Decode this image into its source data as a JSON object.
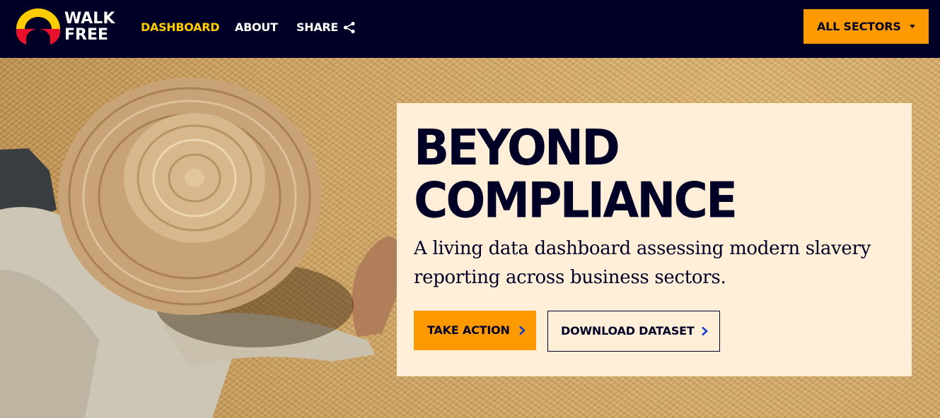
{
  "nav": {
    "logo_text": [
      "WALK",
      "FREE"
    ],
    "links": [
      {
        "label": "DASHBOARD",
        "active": true
      },
      {
        "label": "ABOUT",
        "active": false
      },
      {
        "label": "SHARE",
        "active": false
      }
    ],
    "share_icon": "share-icon",
    "sectors_dropdown": {
      "label": "ALL SECTORS",
      "icon": "caret-down-icon"
    }
  },
  "hero": {
    "image": "farmer-straw-hat-drying-grain",
    "title_lines": [
      "BEYOND",
      "COMPLIANCE"
    ],
    "subtitle": "A living data dashboard assessing modern slavery reporting across business sectors.",
    "buttons": [
      {
        "label": "TAKE ACTION",
        "icon": "chevron-right-icon"
      },
      {
        "label": "DOWNLOAD DATASET",
        "icon": "chevron-right-icon"
      }
    ]
  },
  "colors": {
    "navy": "#000027",
    "accent_yellow": "#ffcc00",
    "accent_orange": "#ff9900",
    "card_bg": "#ffeed8",
    "chevron_blue": "#1a3fcc",
    "logo_red": "#e8102a"
  }
}
